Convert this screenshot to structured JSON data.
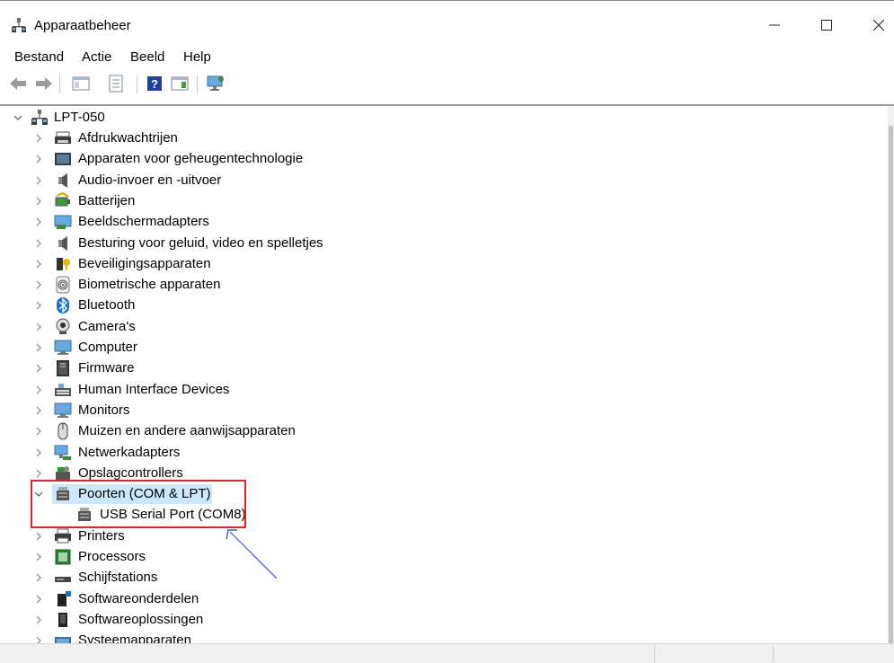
{
  "window": {
    "title": "Apparaatbeheer",
    "minimize": "—",
    "maximize": "☐",
    "close": "✕"
  },
  "menu": [
    "Bestand",
    "Actie",
    "Beeld",
    "Help"
  ],
  "toolbar": {
    "icons": [
      "back-arrow-icon",
      "forward-arrow-icon",
      "show-hide-console-tree-icon",
      "properties-icon",
      "help-icon",
      "action-pane-icon",
      "monitor-scan-icon"
    ]
  },
  "tree": {
    "root": "LPT-050",
    "items": [
      {
        "label": "Afdrukwachtrijen",
        "icon": "print-queue-icon"
      },
      {
        "label": "Apparaten voor geheugentechnologie",
        "icon": "memory-device-icon"
      },
      {
        "label": "Audio-invoer en -uitvoer",
        "icon": "speaker-icon"
      },
      {
        "label": "Batterijen",
        "icon": "battery-icon"
      },
      {
        "label": "Beeldschermadapters",
        "icon": "display-adapter-icon"
      },
      {
        "label": "Besturing voor geluid, video en spelletjes",
        "icon": "speaker-icon"
      },
      {
        "label": "Beveiligingsapparaten",
        "icon": "security-key-icon"
      },
      {
        "label": "Biometrische apparaten",
        "icon": "fingerprint-icon"
      },
      {
        "label": "Bluetooth",
        "icon": "bluetooth-icon"
      },
      {
        "label": "Camera's",
        "icon": "webcam-icon"
      },
      {
        "label": "Computer",
        "icon": "computer-icon"
      },
      {
        "label": "Firmware",
        "icon": "firmware-icon"
      },
      {
        "label": "Human Interface Devices",
        "icon": "hid-icon"
      },
      {
        "label": "Monitors",
        "icon": "monitor-icon"
      },
      {
        "label": "Muizen en andere aanwijsapparaten",
        "icon": "mouse-icon"
      },
      {
        "label": "Netwerkadapters",
        "icon": "network-adapter-icon"
      },
      {
        "label": "Opslagcontrollers",
        "icon": "storage-controller-icon"
      },
      {
        "label": "Poorten (COM & LPT)",
        "icon": "port-connector-icon",
        "expanded": true,
        "selected": true
      },
      {
        "label": "USB Serial Port (COM8)",
        "icon": "port-connector-icon",
        "child": true
      },
      {
        "label": "Printers",
        "icon": "printer-icon"
      },
      {
        "label": "Processors",
        "icon": "processor-icon"
      },
      {
        "label": "Schijfstations",
        "icon": "disk-drive-icon"
      },
      {
        "label": "Softwareonderdelen",
        "icon": "software-component-icon"
      },
      {
        "label": "Softwareoplossingen",
        "icon": "software-solution-icon"
      },
      {
        "label": "Systeemapparaten",
        "icon": "system-device-icon"
      }
    ]
  },
  "colors": {
    "highlight_box": "#d9252b",
    "selection": "#cce8ff",
    "annotation_arrow": "#3c5bb5"
  }
}
